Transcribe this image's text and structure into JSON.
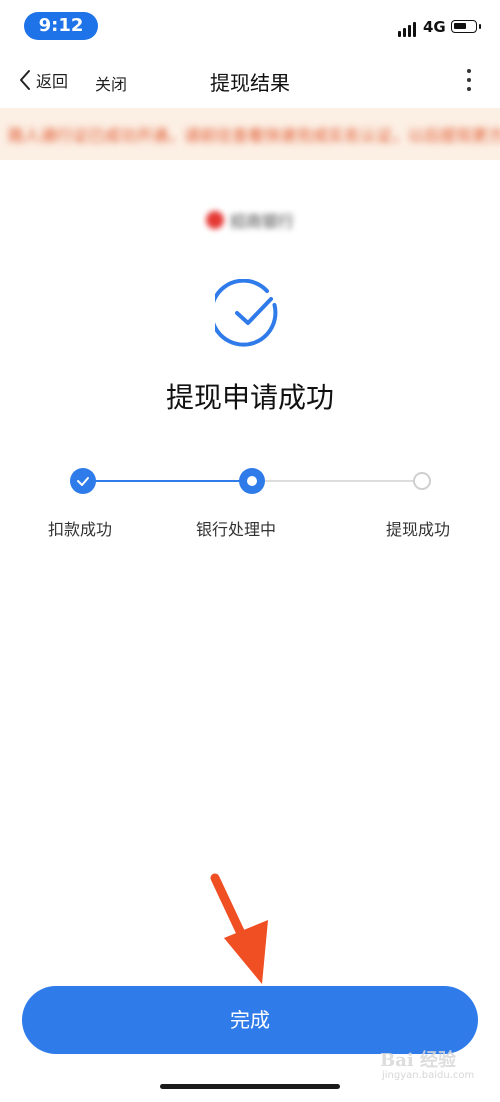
{
  "status_bar": {
    "time": "9:12",
    "network": "4G"
  },
  "nav": {
    "back_label": "返回",
    "close_label": "关闭",
    "title": "提现结果"
  },
  "notice": {
    "text": "路人通行证已成功开通，请前往查看快速完成实名认证，以后提现更方便快捷"
  },
  "bank": {
    "name": "招商银行"
  },
  "result": {
    "title": "提现申请成功"
  },
  "progress": {
    "current_step": 2,
    "steps": [
      {
        "label": "扣款成功",
        "state": "done"
      },
      {
        "label": "银行处理中",
        "state": "current"
      },
      {
        "label": "提现成功",
        "state": "pending"
      }
    ]
  },
  "done_button": {
    "label": "完成"
  },
  "watermark": {
    "main": "Bai 经验",
    "sub": "jingyan.baidu.com"
  },
  "colors": {
    "accent": "#2f7bea",
    "annotation_arrow": "#f04e23",
    "notice_bg": "#fcefe4"
  }
}
